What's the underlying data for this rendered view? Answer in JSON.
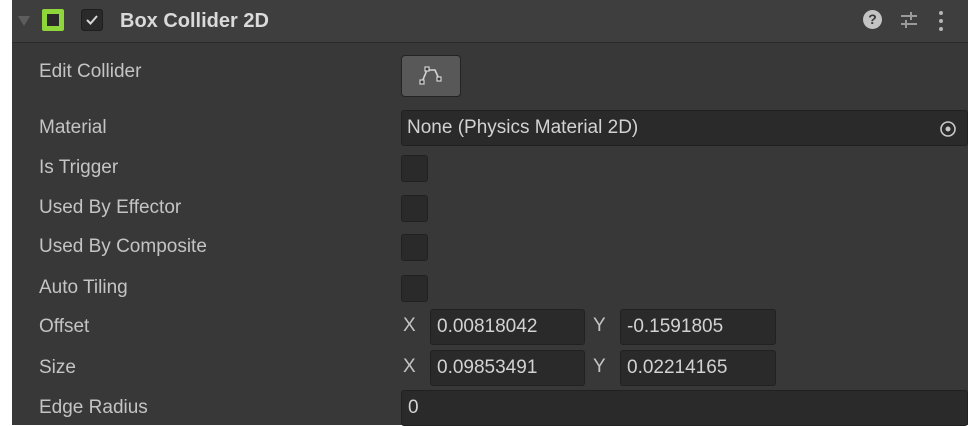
{
  "header": {
    "title": "Box Collider 2D",
    "enabled": true,
    "icon_color": "#8ed63a"
  },
  "icons": {
    "foldout": "foldout-triangle-icon",
    "component": "box-collider-2d-icon",
    "help": "help-icon",
    "presets": "presets-sliders-icon",
    "menu": "kebab-menu-icon",
    "edit_collider": "edit-collider-icon",
    "object_picker": "object-picker-icon"
  },
  "fields": {
    "edit_collider": {
      "label": "Edit Collider"
    },
    "material": {
      "label": "Material",
      "value": "None (Physics Material 2D)"
    },
    "is_trigger": {
      "label": "Is Trigger",
      "checked": false
    },
    "used_by_effector": {
      "label": "Used By Effector",
      "checked": false
    },
    "used_by_composite": {
      "label": "Used By Composite",
      "checked": false
    },
    "auto_tiling": {
      "label": "Auto Tiling",
      "checked": false
    },
    "offset": {
      "label": "Offset",
      "x_label": "X",
      "x": "0.00818042",
      "y_label": "Y",
      "y": "-0.1591805"
    },
    "size": {
      "label": "Size",
      "x_label": "X",
      "x": "0.09853491",
      "y_label": "Y",
      "y": "0.02214165"
    },
    "edge_radius": {
      "label": "Edge Radius",
      "value": "0"
    }
  }
}
